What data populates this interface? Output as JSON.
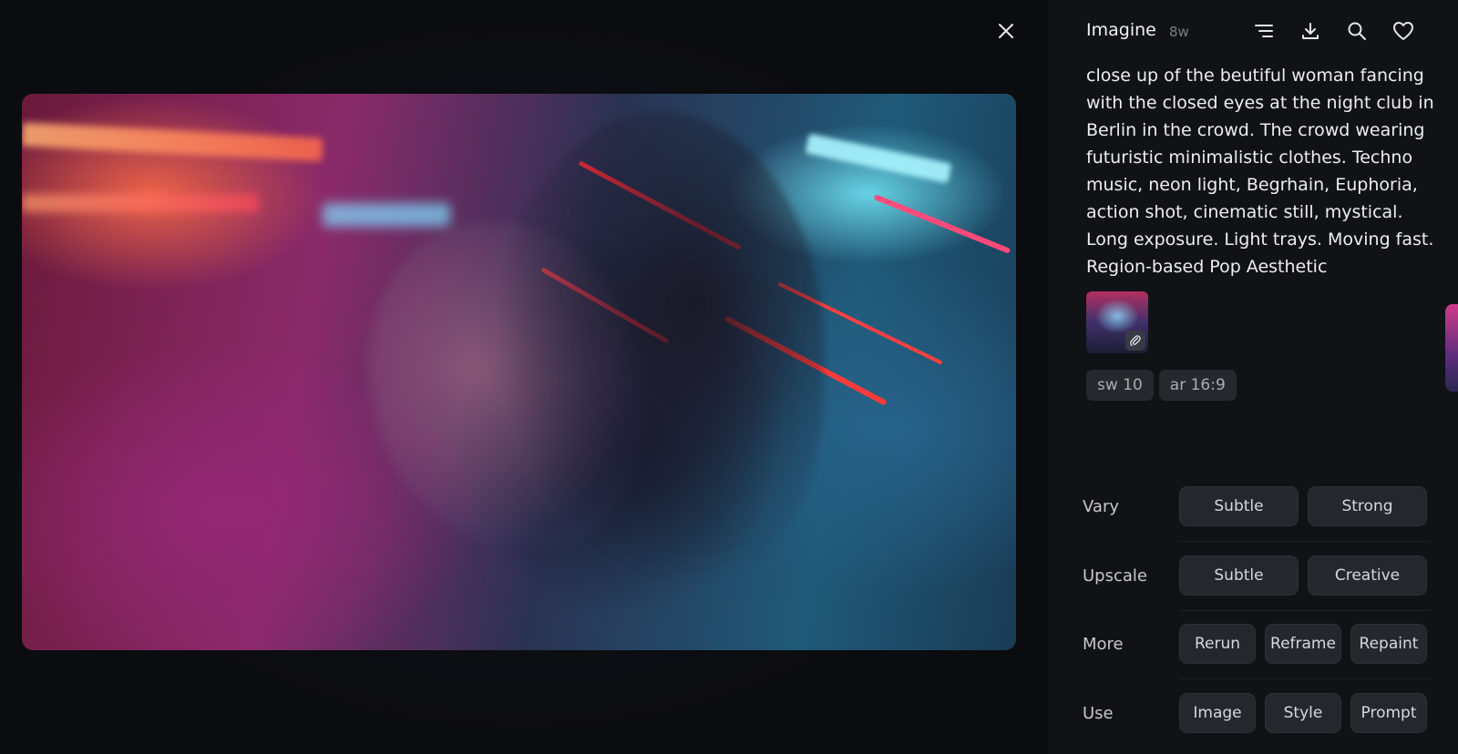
{
  "header": {
    "title": "Imagine",
    "age": "8w"
  },
  "icons": {
    "close": "close-icon",
    "menu": "menu-lines-icon",
    "download": "download-icon",
    "search": "search-icon",
    "favorite": "heart-icon",
    "attachment": "paperclip-icon"
  },
  "prompt": {
    "text": "close up of the beutiful woman fancing with the closed eyes at the night club in Berlin in the crowd. The crowd wearing futuristic minimalistic clothes. Techno music, neon light, Begrhain, Euphoria, action shot, cinematic still, mystical. Long exposure. Light trays. Moving fast. Region-based Pop Aesthetic"
  },
  "parameters": [
    "sw 10",
    "ar 16:9"
  ],
  "actions": [
    {
      "label": "Vary",
      "buttons": [
        "Subtle",
        "Strong"
      ]
    },
    {
      "label": "Upscale",
      "buttons": [
        "Subtle",
        "Creative"
      ]
    },
    {
      "label": "More",
      "buttons": [
        "Rerun",
        "Reframe",
        "Repaint"
      ]
    },
    {
      "label": "Use",
      "buttons": [
        "Image",
        "Style",
        "Prompt"
      ]
    }
  ],
  "colors": {
    "background": "#0b0c10",
    "sidebar": "#111216",
    "button": "#25272d",
    "chip": "#26282e"
  }
}
